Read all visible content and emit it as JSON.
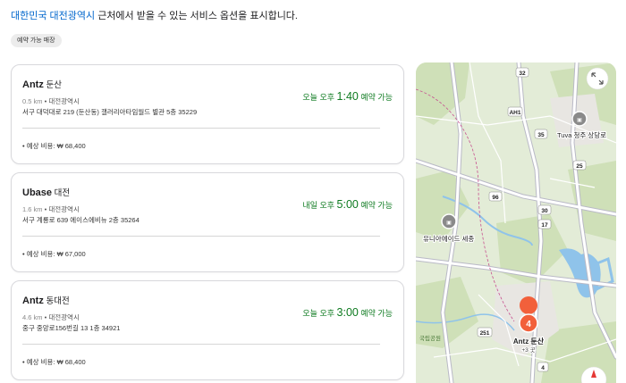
{
  "header": {
    "location": "대한민국 대전광역시",
    "rest": " 근처에서 받을 수 있는 서비스 옵션을 표시합니다."
  },
  "filter_chip": "예약 가능 매장",
  "stores": [
    {
      "name": "Antz",
      "suffix": " 둔산",
      "km": "0.5 km",
      "city": "대전광역시",
      "address": "서구 대덕대로 219 (둔산동) 갤러리아타임월드 별관 5층 35229",
      "price": "예상 비용: ₩ 68,400",
      "avail_pre": "오늘 오후 ",
      "avail_time": "1:40",
      "avail_post": " 예약 가능"
    },
    {
      "name": "Ubase",
      "suffix": " 대전",
      "km": "1.6 km",
      "city": "대전광역시",
      "address": "서구 계룡로 639 에이스에비뉴 2층 35264",
      "price": "예상 비용: ₩ 67,000",
      "avail_pre": "내일 오후 ",
      "avail_time": "5:00",
      "avail_post": " 예약 가능"
    },
    {
      "name": "Antz",
      "suffix": " 동대전",
      "km": "4.6 km",
      "city": "대전광역시",
      "address": "중구 중앙로156번길 13 1층 34921",
      "price": "예상 비용: ₩ 68,400",
      "avail_pre": "오늘 오후 ",
      "avail_time": "3:00",
      "avail_post": " 예약 가능"
    }
  ],
  "dot": "•",
  "map": {
    "route_numbers": [
      "32",
      "AH1",
      "35",
      "25",
      "96",
      "30",
      "17",
      "251",
      "4"
    ],
    "places": {
      "tuva": "Tuva 청주 상당로",
      "uni": "유니아에이드 세종",
      "antz": "Antz 둔산",
      "antz_more": "+3 곳",
      "park": "국립공원"
    },
    "cluster_count": "4",
    "colors": {
      "land": "#e3ecd7",
      "forest": "#cfe0b8",
      "water": "#8fc3ea",
      "road_major": "#ffffff",
      "road_outline": "#b9b9c6",
      "pin": "#f2603b",
      "highway_route": "#c7508f"
    },
    "icons": [
      "expand-icon",
      "compass-icon"
    ]
  }
}
